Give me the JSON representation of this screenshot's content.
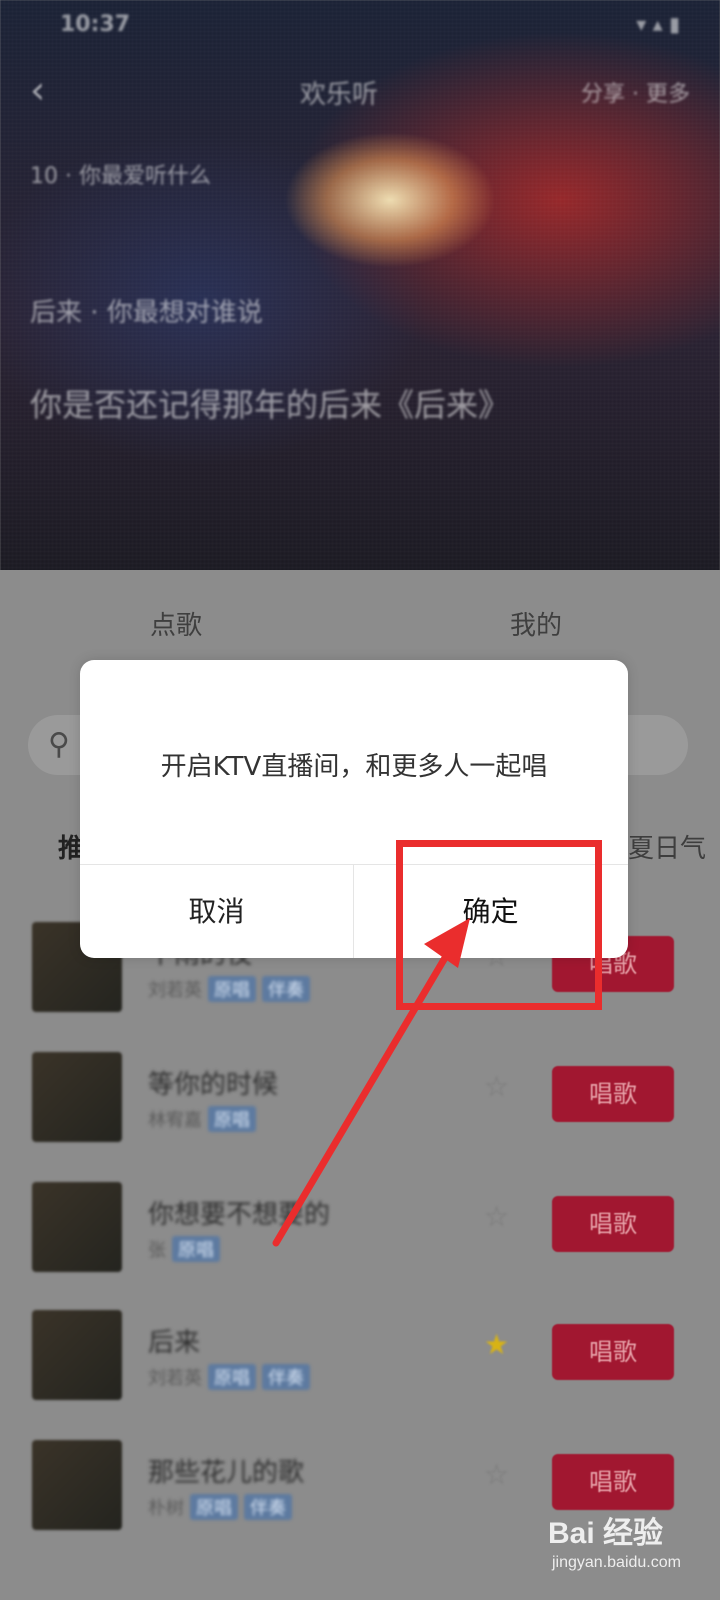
{
  "hero": {
    "status_time": "10:37",
    "status_icons": "▾ ▴ ▮",
    "back_icon": "‹",
    "title": "欢乐听",
    "action": "分享 · 更多",
    "subtitle": "10 · 你最爱听什么",
    "line1": "后来 · 你最想对谁说",
    "line2": "你是否还记得那年的后来《后来》"
  },
  "tabs": [
    "点歌",
    "我的"
  ],
  "category": {
    "left": "推",
    "right": "夏日气"
  },
  "songs": [
    {
      "title": "下雨的夜",
      "meta": "刘若英",
      "tags": [
        "原唱",
        "伴奏"
      ],
      "star": false,
      "button": "唱歌"
    },
    {
      "title": "等你的时候",
      "meta": "林宥嘉",
      "tags": [
        "原唱"
      ],
      "star": false,
      "button": "唱歌"
    },
    {
      "title": "你想要不想要的",
      "meta": "张",
      "tags": [
        "原唱"
      ],
      "star": false,
      "button": "唱歌"
    },
    {
      "title": "后来",
      "meta": "刘若英",
      "tags": [
        "原唱",
        "伴奏"
      ],
      "star": true,
      "button": "唱歌"
    },
    {
      "title": "那些花儿的歌",
      "meta": "朴树",
      "tags": [
        "原唱",
        "伴奏"
      ],
      "star": false,
      "button": "唱歌"
    }
  ],
  "dialog": {
    "message": "开启KTV直播间，和更多人一起唱",
    "cancel": "取消",
    "confirm": "确定"
  },
  "watermark": {
    "main": "Bai 经验",
    "sub": "jingyan.baidu.com"
  },
  "colors": {
    "annotation": "#ea2d2d",
    "sing_button": "#a11730"
  }
}
